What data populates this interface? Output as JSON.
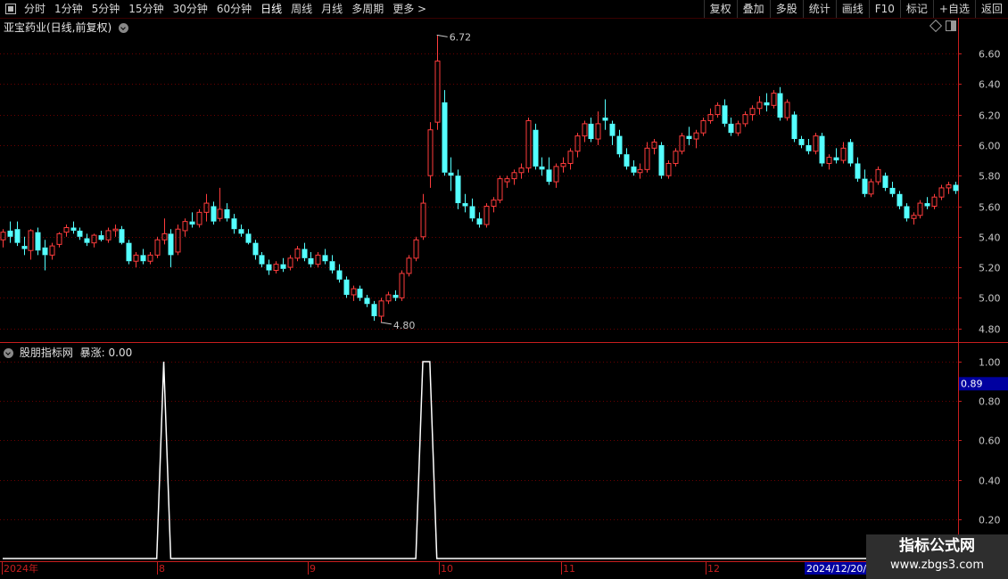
{
  "toolbar": {
    "periods": [
      "分时",
      "1分钟",
      "5分钟",
      "15分钟",
      "30分钟",
      "60分钟",
      "日线",
      "周线",
      "月线",
      "多周期",
      "更多 >"
    ],
    "active_period": "日线",
    "right_buttons": [
      "复权",
      "叠加",
      "多股",
      "统计",
      "画线",
      "F10",
      "标记",
      "+自选",
      "返回"
    ]
  },
  "main_panel": {
    "title": "亚宝药业(日线,前复权)",
    "high_label": "6.72",
    "low_label": "4.80",
    "y_axis": [
      "6.60",
      "6.40",
      "6.20",
      "6.00",
      "5.80",
      "5.60",
      "5.40",
      "5.20",
      "5.00",
      "4.80"
    ]
  },
  "indicator_panel": {
    "name": "股朋指标网",
    "field": "暴涨: 0.00",
    "y_axis": [
      "1.00",
      "0.80",
      "0.60",
      "0.40",
      "0.20"
    ],
    "current_value": "0.89"
  },
  "date_axis": {
    "labels": [
      "2024年",
      "8",
      "9",
      "10",
      "11",
      "12"
    ],
    "highlight": "2024/12/20/"
  },
  "watermark": {
    "line1": "指标公式网",
    "line2": "www.zbgs3.com"
  },
  "colors": {
    "up": "#ff3c3c",
    "down": "#54ffff",
    "grid": "#6a0000",
    "indicator_line": "#ffffff",
    "value_box": "#0000a0"
  },
  "chart_data": [
    {
      "type": "candlestick",
      "title": "亚宝药业(日线,前复权)",
      "ylim": [
        4.75,
        6.75
      ],
      "x_labels": [
        "2024年",
        "8",
        "9",
        "10",
        "11",
        "12"
      ],
      "series": [
        {
          "values": [
            [
              5.38,
              5.45,
              5.33,
              5.43
            ],
            [
              5.44,
              5.5,
              5.36,
              5.4
            ],
            [
              5.45,
              5.5,
              5.34,
              5.36
            ],
            [
              5.34,
              5.4,
              5.28,
              5.32
            ],
            [
              5.31,
              5.45,
              5.25,
              5.44
            ],
            [
              5.43,
              5.46,
              5.28,
              5.31
            ],
            [
              5.33,
              5.38,
              5.18,
              5.28
            ],
            [
              5.28,
              5.36,
              5.25,
              5.34
            ],
            [
              5.35,
              5.43,
              5.33,
              5.42
            ],
            [
              5.43,
              5.48,
              5.4,
              5.46
            ],
            [
              5.46,
              5.5,
              5.42,
              5.44
            ],
            [
              5.44,
              5.46,
              5.38,
              5.4
            ],
            [
              5.39,
              5.42,
              5.34,
              5.36
            ],
            [
              5.36,
              5.42,
              5.33,
              5.41
            ],
            [
              5.41,
              5.44,
              5.37,
              5.38
            ],
            [
              5.38,
              5.46,
              5.36,
              5.44
            ],
            [
              5.44,
              5.48,
              5.4,
              5.45
            ],
            [
              5.45,
              5.47,
              5.35,
              5.36
            ],
            [
              5.36,
              5.38,
              5.22,
              5.24
            ],
            [
              5.24,
              5.3,
              5.2,
              5.28
            ],
            [
              5.28,
              5.32,
              5.22,
              5.24
            ],
            [
              5.24,
              5.3,
              5.22,
              5.28
            ],
            [
              5.28,
              5.4,
              5.26,
              5.38
            ],
            [
              5.38,
              5.52,
              5.35,
              5.42
            ],
            [
              5.42,
              5.45,
              5.2,
              5.28
            ],
            [
              5.3,
              5.48,
              5.28,
              5.45
            ],
            [
              5.44,
              5.52,
              5.4,
              5.5
            ],
            [
              5.5,
              5.56,
              5.46,
              5.48
            ],
            [
              5.48,
              5.58,
              5.46,
              5.56
            ],
            [
              5.56,
              5.68,
              5.5,
              5.62
            ],
            [
              5.6,
              5.63,
              5.48,
              5.5
            ],
            [
              5.52,
              5.72,
              5.5,
              5.58
            ],
            [
              5.58,
              5.62,
              5.5,
              5.52
            ],
            [
              5.52,
              5.55,
              5.42,
              5.45
            ],
            [
              5.45,
              5.48,
              5.4,
              5.42
            ],
            [
              5.42,
              5.45,
              5.35,
              5.36
            ],
            [
              5.36,
              5.38,
              5.25,
              5.28
            ],
            [
              5.28,
              5.3,
              5.2,
              5.22
            ],
            [
              5.22,
              5.25,
              5.15,
              5.18
            ],
            [
              5.18,
              5.24,
              5.16,
              5.22
            ],
            [
              5.22,
              5.26,
              5.17,
              5.19
            ],
            [
              5.2,
              5.28,
              5.18,
              5.26
            ],
            [
              5.26,
              5.34,
              5.24,
              5.32
            ],
            [
              5.32,
              5.36,
              5.24,
              5.26
            ],
            [
              5.26,
              5.3,
              5.2,
              5.22
            ],
            [
              5.22,
              5.3,
              5.2,
              5.28
            ],
            [
              5.28,
              5.32,
              5.22,
              5.24
            ],
            [
              5.24,
              5.28,
              5.16,
              5.18
            ],
            [
              5.18,
              5.22,
              5.1,
              5.12
            ],
            [
              5.12,
              5.14,
              5.0,
              5.02
            ],
            [
              5.02,
              5.08,
              4.98,
              5.06
            ],
            [
              5.06,
              5.08,
              4.98,
              5.0
            ],
            [
              5.0,
              5.02,
              4.94,
              4.96
            ],
            [
              4.96,
              4.98,
              4.85,
              4.88
            ],
            [
              4.88,
              5.0,
              4.84,
              4.98
            ],
            [
              4.98,
              5.04,
              4.96,
              5.02
            ],
            [
              5.02,
              5.05,
              4.98,
              5.0
            ],
            [
              5.0,
              5.18,
              4.98,
              5.16
            ],
            [
              5.16,
              5.28,
              5.14,
              5.26
            ],
            [
              5.26,
              5.4,
              5.24,
              5.38
            ],
            [
              5.4,
              5.68,
              5.38,
              5.62
            ],
            [
              5.8,
              6.15,
              5.72,
              6.1
            ],
            [
              6.15,
              6.72,
              6.1,
              6.55
            ],
            [
              6.28,
              6.36,
              5.8,
              5.82
            ],
            [
              5.82,
              5.92,
              5.7,
              5.8
            ],
            [
              5.8,
              5.84,
              5.58,
              5.62
            ],
            [
              5.62,
              5.68,
              5.56,
              5.6
            ],
            [
              5.6,
              5.65,
              5.5,
              5.52
            ],
            [
              5.52,
              5.56,
              5.46,
              5.48
            ],
            [
              5.48,
              5.62,
              5.46,
              5.6
            ],
            [
              5.6,
              5.66,
              5.56,
              5.64
            ],
            [
              5.64,
              5.8,
              5.62,
              5.78
            ],
            [
              5.76,
              5.8,
              5.72,
              5.78
            ],
            [
              5.78,
              5.84,
              5.74,
              5.82
            ],
            [
              5.82,
              5.88,
              5.78,
              5.85
            ],
            [
              5.85,
              6.18,
              5.82,
              6.16
            ],
            [
              6.1,
              6.14,
              5.84,
              5.86
            ],
            [
              5.86,
              5.92,
              5.8,
              5.84
            ],
            [
              5.84,
              5.92,
              5.74,
              5.76
            ],
            [
              5.76,
              5.88,
              5.72,
              5.86
            ],
            [
              5.86,
              5.92,
              5.82,
              5.88
            ],
            [
              5.88,
              5.98,
              5.84,
              5.96
            ],
            [
              5.96,
              6.08,
              5.92,
              6.06
            ],
            [
              6.06,
              6.16,
              6.02,
              6.14
            ],
            [
              6.14,
              6.18,
              6.02,
              6.04
            ],
            [
              6.04,
              6.22,
              6.0,
              6.14
            ],
            [
              6.18,
              6.3,
              6.1,
              6.16
            ],
            [
              6.14,
              6.16,
              6.0,
              6.06
            ],
            [
              6.06,
              6.1,
              5.92,
              5.94
            ],
            [
              5.94,
              5.98,
              5.84,
              5.86
            ],
            [
              5.86,
              5.9,
              5.8,
              5.82
            ],
            [
              5.82,
              5.88,
              5.78,
              5.84
            ],
            [
              5.84,
              6.02,
              5.82,
              5.98
            ],
            [
              5.98,
              6.04,
              5.94,
              6.02
            ],
            [
              6.0,
              6.02,
              5.78,
              5.8
            ],
            [
              5.8,
              5.9,
              5.78,
              5.88
            ],
            [
              5.88,
              5.98,
              5.86,
              5.96
            ],
            [
              5.96,
              6.08,
              5.94,
              6.06
            ],
            [
              6.06,
              6.12,
              6.0,
              6.04
            ],
            [
              6.04,
              6.1,
              5.98,
              6.08
            ],
            [
              6.08,
              6.18,
              6.06,
              6.16
            ],
            [
              6.16,
              6.24,
              6.14,
              6.2
            ],
            [
              6.2,
              6.28,
              6.18,
              6.26
            ],
            [
              6.26,
              6.3,
              6.12,
              6.14
            ],
            [
              6.14,
              6.18,
              6.06,
              6.08
            ],
            [
              6.08,
              6.16,
              6.06,
              6.14
            ],
            [
              6.14,
              6.22,
              6.12,
              6.2
            ],
            [
              6.2,
              6.26,
              6.16,
              6.24
            ],
            [
              6.24,
              6.32,
              6.2,
              6.28
            ],
            [
              6.28,
              6.34,
              6.22,
              6.26
            ],
            [
              6.26,
              6.36,
              6.24,
              6.34
            ],
            [
              6.34,
              6.38,
              6.16,
              6.18
            ],
            [
              6.18,
              6.3,
              6.16,
              6.28
            ],
            [
              6.2,
              6.22,
              6.02,
              6.04
            ],
            [
              6.04,
              6.06,
              5.98,
              6.0
            ],
            [
              6.0,
              6.04,
              5.94,
              5.96
            ],
            [
              5.96,
              6.08,
              5.94,
              6.06
            ],
            [
              6.06,
              6.08,
              5.86,
              5.88
            ],
            [
              5.88,
              5.94,
              5.84,
              5.92
            ],
            [
              5.92,
              5.98,
              5.88,
              5.9
            ],
            [
              5.9,
              6.02,
              5.88,
              5.98
            ],
            [
              6.02,
              6.04,
              5.86,
              5.88
            ],
            [
              5.88,
              5.92,
              5.76,
              5.78
            ],
            [
              5.78,
              5.84,
              5.66,
              5.68
            ],
            [
              5.68,
              5.78,
              5.66,
              5.76
            ],
            [
              5.76,
              5.86,
              5.74,
              5.84
            ],
            [
              5.8,
              5.82,
              5.7,
              5.72
            ],
            [
              5.72,
              5.76,
              5.66,
              5.68
            ],
            [
              5.68,
              5.7,
              5.58,
              5.6
            ],
            [
              5.6,
              5.62,
              5.5,
              5.52
            ],
            [
              5.52,
              5.56,
              5.48,
              5.54
            ],
            [
              5.54,
              5.64,
              5.52,
              5.62
            ],
            [
              5.62,
              5.66,
              5.58,
              5.6
            ],
            [
              5.6,
              5.68,
              5.58,
              5.66
            ],
            [
              5.66,
              5.74,
              5.64,
              5.72
            ],
            [
              5.72,
              5.76,
              5.68,
              5.74
            ],
            [
              5.74,
              5.76,
              5.68,
              5.7
            ]
          ]
        }
      ]
    },
    {
      "type": "line",
      "title": "股朋指标网 暴涨",
      "ylim": [
        0,
        1.0
      ],
      "series": [
        {
          "name": "暴涨",
          "values": [
            [
              0,
              0
            ],
            [
              22,
              0
            ],
            [
              23,
              1
            ],
            [
              24,
              0
            ],
            [
              59,
              0
            ],
            [
              60,
              1
            ],
            [
              61,
              1
            ],
            [
              62,
              0
            ],
            [
              135,
              0
            ]
          ]
        }
      ]
    }
  ]
}
